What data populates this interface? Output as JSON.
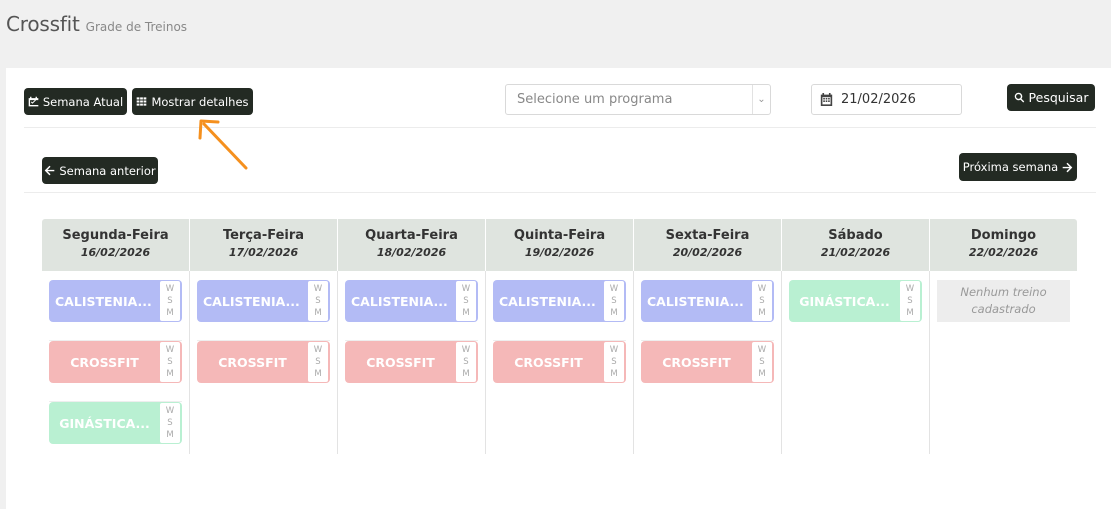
{
  "header": {
    "title": "Crossfit",
    "subtitle": "Grade de Treinos"
  },
  "toolbar": {
    "current_week_label": "Semana Atual",
    "show_details_label": "Mostrar detalhes",
    "program_placeholder": "Selecione um programa",
    "date_value": "21/02/2026",
    "search_label": "Pesquisar"
  },
  "week_nav": {
    "prev_label": "Semana anterior",
    "next_label": "Próxima semana"
  },
  "days": [
    {
      "name": "Segunda-Feira",
      "date": "16/02/2026"
    },
    {
      "name": "Terça-Feira",
      "date": "17/02/2026"
    },
    {
      "name": "Quarta-Feira",
      "date": "18/02/2026"
    },
    {
      "name": "Quinta-Feira",
      "date": "19/02/2026"
    },
    {
      "name": "Sexta-Feira",
      "date": "20/02/2026"
    },
    {
      "name": "Sábado",
      "date": "21/02/2026"
    },
    {
      "name": "Domingo",
      "date": "22/02/2026"
    }
  ],
  "workouts": {
    "calistenia": "CALISTENIA...",
    "crossfit": "CROSSFIT",
    "ginastica": "GINÁSTICA...",
    "wsm": [
      "W",
      "S",
      "M"
    ],
    "empty": "Nenhum treino cadastrado"
  },
  "colors": {
    "calistenia": "#b3bbf5",
    "crossfit": "#f5b8b8",
    "ginastica": "#b9f0d2",
    "button_dark": "#232a23",
    "annotation_arrow": "#f5901e"
  }
}
